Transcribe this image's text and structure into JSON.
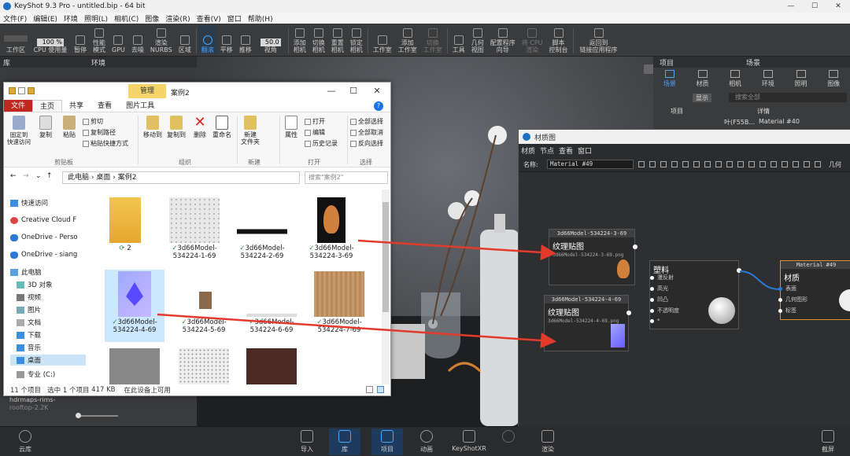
{
  "app": {
    "title": "KeyShot 9.3 Pro - untitled.bip - 64 bit",
    "menu": [
      "文件(F)",
      "编辑(E)",
      "环境",
      "照明(L)",
      "相机(C)",
      "图像",
      "渲染(R)",
      "查看(V)",
      "窗口",
      "帮助(H)"
    ],
    "window_buttons": [
      "—",
      "☐",
      "✕"
    ]
  },
  "toolbar": {
    "zoom_value": "100 %",
    "fps_value": "50.0",
    "items": [
      {
        "label": "工作区"
      },
      {
        "label": "CPU 使用量"
      },
      {
        "label": "暂停"
      },
      {
        "label": "性能\n模式"
      },
      {
        "label": "GPU"
      },
      {
        "label": "去噪"
      },
      {
        "label": "渲染\nNURBS"
      },
      {
        "label": "区域"
      },
      {
        "label": "翻滚"
      },
      {
        "label": "平移"
      },
      {
        "label": "推移"
      },
      {
        "label": "视角"
      },
      {
        "label": "添加\n相机"
      },
      {
        "label": "切换\n相机"
      },
      {
        "label": "重置\n相机"
      },
      {
        "label": "锁定\n相机"
      },
      {
        "label": "工作室"
      },
      {
        "label": "添加\n工作室"
      },
      {
        "label": "切换\n工作室"
      },
      {
        "label": "工具"
      },
      {
        "label": "几何\n视图"
      },
      {
        "label": "配置程序\n向导"
      },
      {
        "label": "将 CPU\n渲染"
      },
      {
        "label": "脚本\n控制台"
      },
      {
        "label": "返回到\n链接应用程序"
      }
    ]
  },
  "library": {
    "head_a": "库",
    "head_b": "环境",
    "bottom_text": "hdrmaps-rims-",
    "bottom_text2": "rooftop-2.2K",
    "cloud_label": "云库"
  },
  "scene": {
    "head_a": "项目",
    "head_b": "场景",
    "tabs": [
      "场景",
      "材质",
      "相机",
      "环境",
      "照明",
      "图像"
    ],
    "show_label": "显示",
    "search_placeholder": "搜索全部",
    "col_item": "项目",
    "col_detail": "详情",
    "row_name": "叶(F55B...",
    "row_material": "Material #40"
  },
  "bottom_bar": [
    "导入",
    "库",
    "项目",
    "动画",
    "KeyShotXR",
    "",
    "渲染"
  ],
  "bottom_right": "截屏",
  "explorer": {
    "manage_tab": "管理",
    "folder_name": "案例2",
    "tabs": [
      "文件",
      "主页",
      "共享",
      "查看",
      "图片工具"
    ],
    "ribbon": {
      "clipboard": {
        "pin": "固定到\n快速访问",
        "copy": "复制",
        "paste": "粘贴",
        "cut": "剪切",
        "copy_path": "复制路径",
        "paste_shortcut": "粘贴快捷方式",
        "group": "剪贴板"
      },
      "organize": {
        "move_to": "移动到",
        "copy_to": "复制到",
        "delete": "删除",
        "rename": "重命名",
        "group": "组织"
      },
      "new": {
        "new_folder": "新建\n文件夹",
        "group": "新建"
      },
      "open": {
        "properties": "属性",
        "open": "打开",
        "edit": "编辑",
        "history": "历史记录",
        "group": "打开"
      },
      "select": {
        "all": "全部选择",
        "none": "全部取消",
        "invert": "反向选择",
        "group": "选择"
      }
    },
    "address": [
      "此电脑",
      "桌面",
      "案例2"
    ],
    "search_placeholder": "搜索\"案例2\"",
    "nav": [
      "快速访问",
      "Creative Cloud F",
      "OneDrive - Perso",
      "OneDrive - siang",
      "此电脑",
      "3D 对象",
      "视频",
      "图片",
      "文档",
      "下载",
      "音乐",
      "桌面",
      "专业 (C:)"
    ],
    "files": [
      {
        "name": "2",
        "status": "sync"
      },
      {
        "name": "3d66Model-534224-1-69",
        "status": "ok"
      },
      {
        "name": "3d66Model-534224-2-69",
        "status": "ok"
      },
      {
        "name": "3d66Model-534224-3-69",
        "status": "ok"
      },
      {
        "name": "3d66Model-534224-4-69",
        "status": "ok"
      },
      {
        "name": "3d66Model-534224-5-69",
        "status": "ok"
      },
      {
        "name": "3d66Model-534224-6-69",
        "status": "ok"
      },
      {
        "name": "3d66Model-534224-7-69",
        "status": "ok"
      }
    ],
    "status": {
      "count": "11 个项目",
      "selected": "选中 1 个项目",
      "size": "417 KB",
      "avail": "在此设备上可用"
    }
  },
  "material_graph": {
    "title": "材质图",
    "menu": [
      "材质",
      "节点",
      "查看",
      "窗口"
    ],
    "name_label": "名称:",
    "name_value": "Material #49",
    "tool_right": "几何",
    "node1": {
      "header": "3d66Model-534224-3-69",
      "title": "纹理贴图",
      "path": "3d66Model-534224-3-69.png"
    },
    "node2": {
      "header": "3d66Model-534224-4-69",
      "title": "纹理贴图",
      "path": "3d66Model-534224-4-69.png"
    },
    "node3": {
      "title": "塑料",
      "ports": [
        "漫反射",
        "高光",
        "凹凸",
        "不透明度",
        "*"
      ]
    },
    "node4": {
      "header": "Material #49",
      "title": "材质",
      "ports": [
        "表面",
        "几何图形",
        "标签"
      ]
    }
  }
}
